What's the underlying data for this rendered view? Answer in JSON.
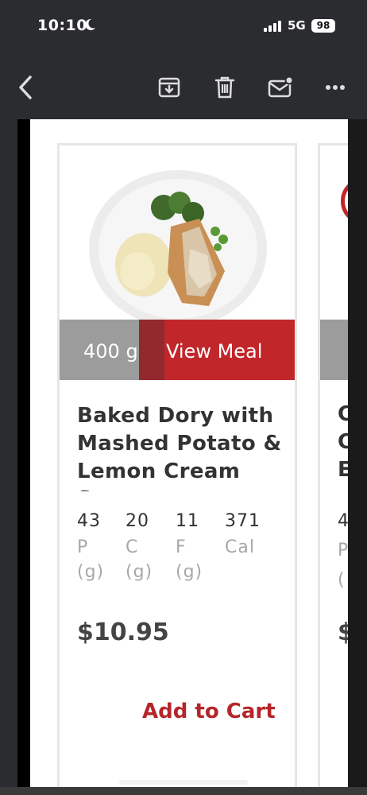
{
  "status": {
    "time": "10:10",
    "network": "5G",
    "battery": "98"
  },
  "toolbar": {
    "back_icon": "chevron-left-icon",
    "archive_icon": "archive-icon",
    "delete_icon": "trash-icon",
    "mark_unread_icon": "mail-dot-icon",
    "more_icon": "more-horizontal-icon"
  },
  "meal": {
    "weight": "400 g",
    "view_label": "View Meal",
    "title": "Baked Dory with Mashed Potato & Lemon Cream Sauce",
    "macros": [
      {
        "value": "43",
        "label": "P",
        "unit": "(g)"
      },
      {
        "value": "20",
        "label": "C",
        "unit": "(g)"
      },
      {
        "value": "11",
        "label": "F",
        "unit": "(g)"
      },
      {
        "value": "371",
        "label": "Cal",
        "unit": ""
      }
    ],
    "price": "$10.95",
    "add_to_cart": "Add to Cart"
  },
  "next_card": {
    "title_letters": [
      "C",
      "C",
      "E"
    ],
    "macro_value": "4",
    "macro_label": "P",
    "macro_unit": "(",
    "price": "$"
  },
  "colors": {
    "accent": "#c1262b",
    "weight_bg": "#9c9c9c",
    "dark_bar": "#2b2c2f"
  }
}
